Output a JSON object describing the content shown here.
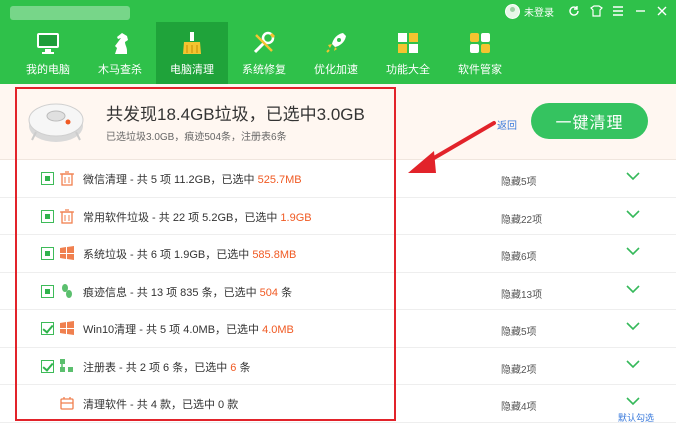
{
  "topbar": {
    "login_label": "未登录",
    "icons": [
      "avatar-icon",
      "refresh-icon",
      "skin-icon",
      "menu-icon",
      "minimize-icon",
      "close-icon"
    ]
  },
  "nav": {
    "items": [
      {
        "label": "我的电脑",
        "icon": "monitor-icon"
      },
      {
        "label": "木马查杀",
        "icon": "horse-icon"
      },
      {
        "label": "电脑清理",
        "icon": "broom-icon"
      },
      {
        "label": "系统修复",
        "icon": "wrench-icon"
      },
      {
        "label": "优化加速",
        "icon": "rocket-icon"
      },
      {
        "label": "功能大全",
        "icon": "grid-icon"
      },
      {
        "label": "软件管家",
        "icon": "apps-icon"
      }
    ],
    "active_index": 2
  },
  "header": {
    "headline": "共发现18.4GB垃圾，已选中3.0GB",
    "subline": "已选垃圾3.0GB，痕迹504条，注册表6条",
    "back_link": "返回",
    "clean_button": "一键清理"
  },
  "rows": [
    {
      "icon": "trash-icon",
      "checkbox": "partial",
      "prefix": "微信清理 - 共 5 项 11.2GB，已选中 ",
      "highlight": "525.7MB",
      "suffix": "",
      "hidden": "隐藏5项"
    },
    {
      "icon": "trash-icon",
      "checkbox": "partial",
      "prefix": "常用软件垃圾 - 共 22 项 5.2GB，已选中 ",
      "highlight": "1.9GB",
      "suffix": "",
      "hidden": "隐藏22项"
    },
    {
      "icon": "windows-icon",
      "checkbox": "partial",
      "prefix": "系统垃圾 - 共 6 项 1.9GB，已选中 ",
      "highlight": "585.8MB",
      "suffix": "",
      "hidden": "隐藏6项"
    },
    {
      "icon": "footprint-icon",
      "checkbox": "partial",
      "prefix": "痕迹信息 - 共 13 项 835 条，已选中 ",
      "highlight": "504",
      "suffix": " 条",
      "hidden": "隐藏13项"
    },
    {
      "icon": "windows-icon",
      "checkbox": "checked",
      "prefix": "Win10清理 - 共 5 项 4.0MB，已选中 ",
      "highlight": "4.0MB",
      "suffix": "",
      "hidden": "隐藏5项"
    },
    {
      "icon": "registry-icon",
      "checkbox": "checked",
      "prefix": "注册表 - 共 2 项 6 条，已选中 ",
      "highlight": "6",
      "suffix": " 条",
      "hidden": "隐藏2项"
    },
    {
      "icon": "software-icon",
      "checkbox": "none",
      "prefix": "清理软件 - 共 4 款，已选中 0 款",
      "highlight": "",
      "suffix": "",
      "hidden": "隐藏4项"
    }
  ],
  "default_check_link": "默认勾选",
  "colors": {
    "brand_green": "#2fc14a",
    "active_tab": "#1fa33a",
    "highlight_orange": "#f05a23",
    "annotation_red": "#e2232a"
  }
}
